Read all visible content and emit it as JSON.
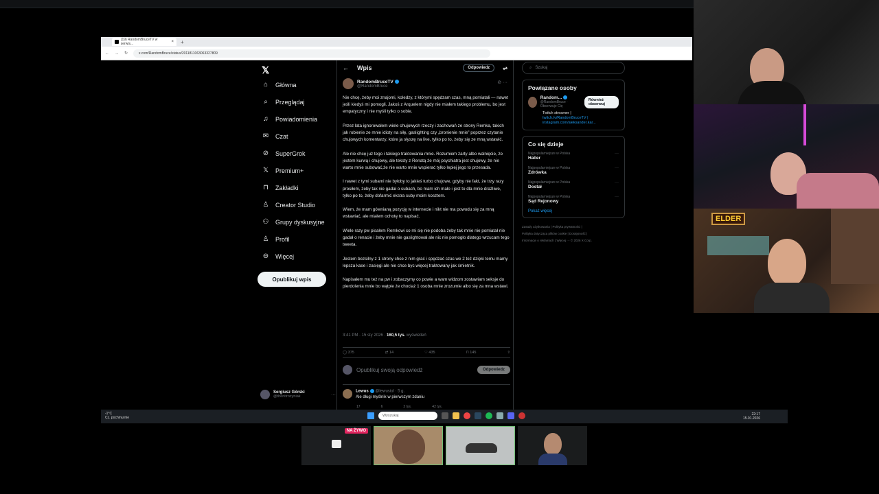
{
  "browser": {
    "tab_title": "(19) RandomBruceTV w serwis...",
    "url": "x.com/RandomBruce/status/2011811063063327809"
  },
  "nav": {
    "items": [
      {
        "label": "Główna",
        "icon": "home-icon"
      },
      {
        "label": "Przeglądaj",
        "icon": "search-icon"
      },
      {
        "label": "Powiadomienia",
        "icon": "bell-icon"
      },
      {
        "label": "Czat",
        "icon": "mail-icon"
      },
      {
        "label": "SuperGrok",
        "icon": "grok-icon"
      },
      {
        "label": "Premium+",
        "icon": "x-premium-icon"
      },
      {
        "label": "Zakładki",
        "icon": "bookmark-icon"
      },
      {
        "label": "Creator Studio",
        "icon": "creator-icon"
      },
      {
        "label": "Grupy dyskusyjne",
        "icon": "groups-icon"
      },
      {
        "label": "Profil",
        "icon": "person-icon"
      },
      {
        "label": "Więcej",
        "icon": "more-icon"
      }
    ],
    "post_button": "Opublikuj wpis",
    "me_name": "Sergiusz Górski",
    "me_handle": "@thenitrozyniak"
  },
  "post": {
    "header_title": "Wpis",
    "header_reply": "Odpowiedz",
    "author_name": "RandomBruceTV",
    "author_handle": "@RandomBruce",
    "paragraphs": [
      "Nie chcę, żeby moi znajomi, koledzy, z którymi spędzam czas, mną pomiatali — nawet jeśli kiedyś mi pomogli. Jakoś z Arquelem nigdy nie miałem takiego problemu, bo jest empatyczny i nie myśli tylko o sobie.",
      "Przez lata ignorowałem wiele chujowych rzeczy i zachowań ze strony Remka, takich jak robienie ze mnie idioty na siłę, gaslighting czy „bronienie mnie” poprzez czytanie chujowych komentarzy, które ja słyszę na live, tylko po to, żeby się ze mną wstawić.",
      "Ale nie chcę już tego i takiego traktowania mnie. Rozumiem żarty albo walnięcie, że jestem kurwą i chujowy, ale teksty z Renatą  że mój psychiatra jest chujowy, że nie warto mnie subować,że nie warto mnie wspierać tylko lepiej jego  to przesada.",
      "I nawet z tymi subami nie byłoby to jakieś turbo chujowe, gdyby nie fakt, że trzy razy prosiłem, żeby tak nie gadał o subach, bo mam ich mało i jest to dla mnie drażliwe, tylko po to, żeby dofarmić ekstra suby moim kosztem.",
      "Wiem, że mam gównianą pozycję w internecie i nikt nie ma powodu się za mną wstawiać, ale miałem ochotę to napisać.",
      "Wiele razy pw pisałem Remkowi co mi się nie podoba żeby tak mnie nie pomiatał nie gadał o renacie i żeby mnie nie gaslightował ale nic nie pomogło dlatego wrzucam tego tweeta.",
      "Jestem bezsilny z 1 strony chce z nim grać i spędzać czas we 2 też dzięki temu mamy lepsza kase i zasięgi ale nie chce byc więcej traktowany jak śmietnik.",
      "Napisałem mu też na pw i zobaczymy co powie a wam widzom zostawiam seksje do pierdolenia mnie bo wątpie że chociaż 1 osoba mnie zrozumie albo się za mna wstawi."
    ],
    "time": "3:41 PM · 15 sty 2026 ·",
    "views_count": "160,5 tys.",
    "views_label": "wyświetleń",
    "stats": {
      "replies": "375",
      "reposts": "14",
      "likes": "435",
      "bookmarks": "145"
    },
    "compose_placeholder": "Opublikuj swoją odpowiedź",
    "compose_button": "Odpowiedz"
  },
  "reply": {
    "name": "Lewus",
    "handle": "@lewusiol · 5 g.",
    "text": "Ale długi myślnik w pierwszym zdaniu",
    "stats": {
      "replies": "17",
      "reposts": "6",
      "likes": "2 tys.",
      "views": "42 tys."
    }
  },
  "sidebar": {
    "search_placeholder": "Szukaj",
    "related_title": "Powiązane osoby",
    "related_name": "Random...",
    "related_handle": "@RandomBruce · Obserwuje Cię",
    "follow_button": "Również obserwuj",
    "bio_text": "Twitch streamer |",
    "bio_link1": "twitch.tv/RandomBruceTV |",
    "bio_link2": "instagram.com/aleksander.kar...",
    "trends_title": "Co się dzieje",
    "trends": [
      {
        "context": "Najpopularniejsze w Polska",
        "name": "Haller"
      },
      {
        "context": "Najpopularniejsze w Polska",
        "name": "Zdrówka"
      },
      {
        "context": "Najpopularniejsze w Polska",
        "name": "Dostał"
      },
      {
        "context": "Najpopularniejsze w Polska",
        "name": "Sąd Rejonowy"
      }
    ],
    "show_more": "Pokaż więcej",
    "footer_line1": "Zasady użytkowania  |  Polityka prywatności  |",
    "footer_line2": "Polityka dotycząca plików cookie  |  Dostępność  |",
    "footer_line3": "Informacje o reklamach  |  Więcej ···  © 2026 X Corp."
  },
  "taskbar": {
    "weather_top": "-1°C",
    "weather_bottom": "Cz. pochmurnie",
    "search_placeholder": "Wyszukaj",
    "time": "22:17",
    "date": "15.01.2026"
  },
  "stream": {
    "overlay_text": "ELDER",
    "live_badge": "NA ŻYWO"
  },
  "colors": {
    "accent": "#1d9bf0",
    "background": "#000000",
    "border": "#2f3336",
    "muted": "#71767b"
  }
}
